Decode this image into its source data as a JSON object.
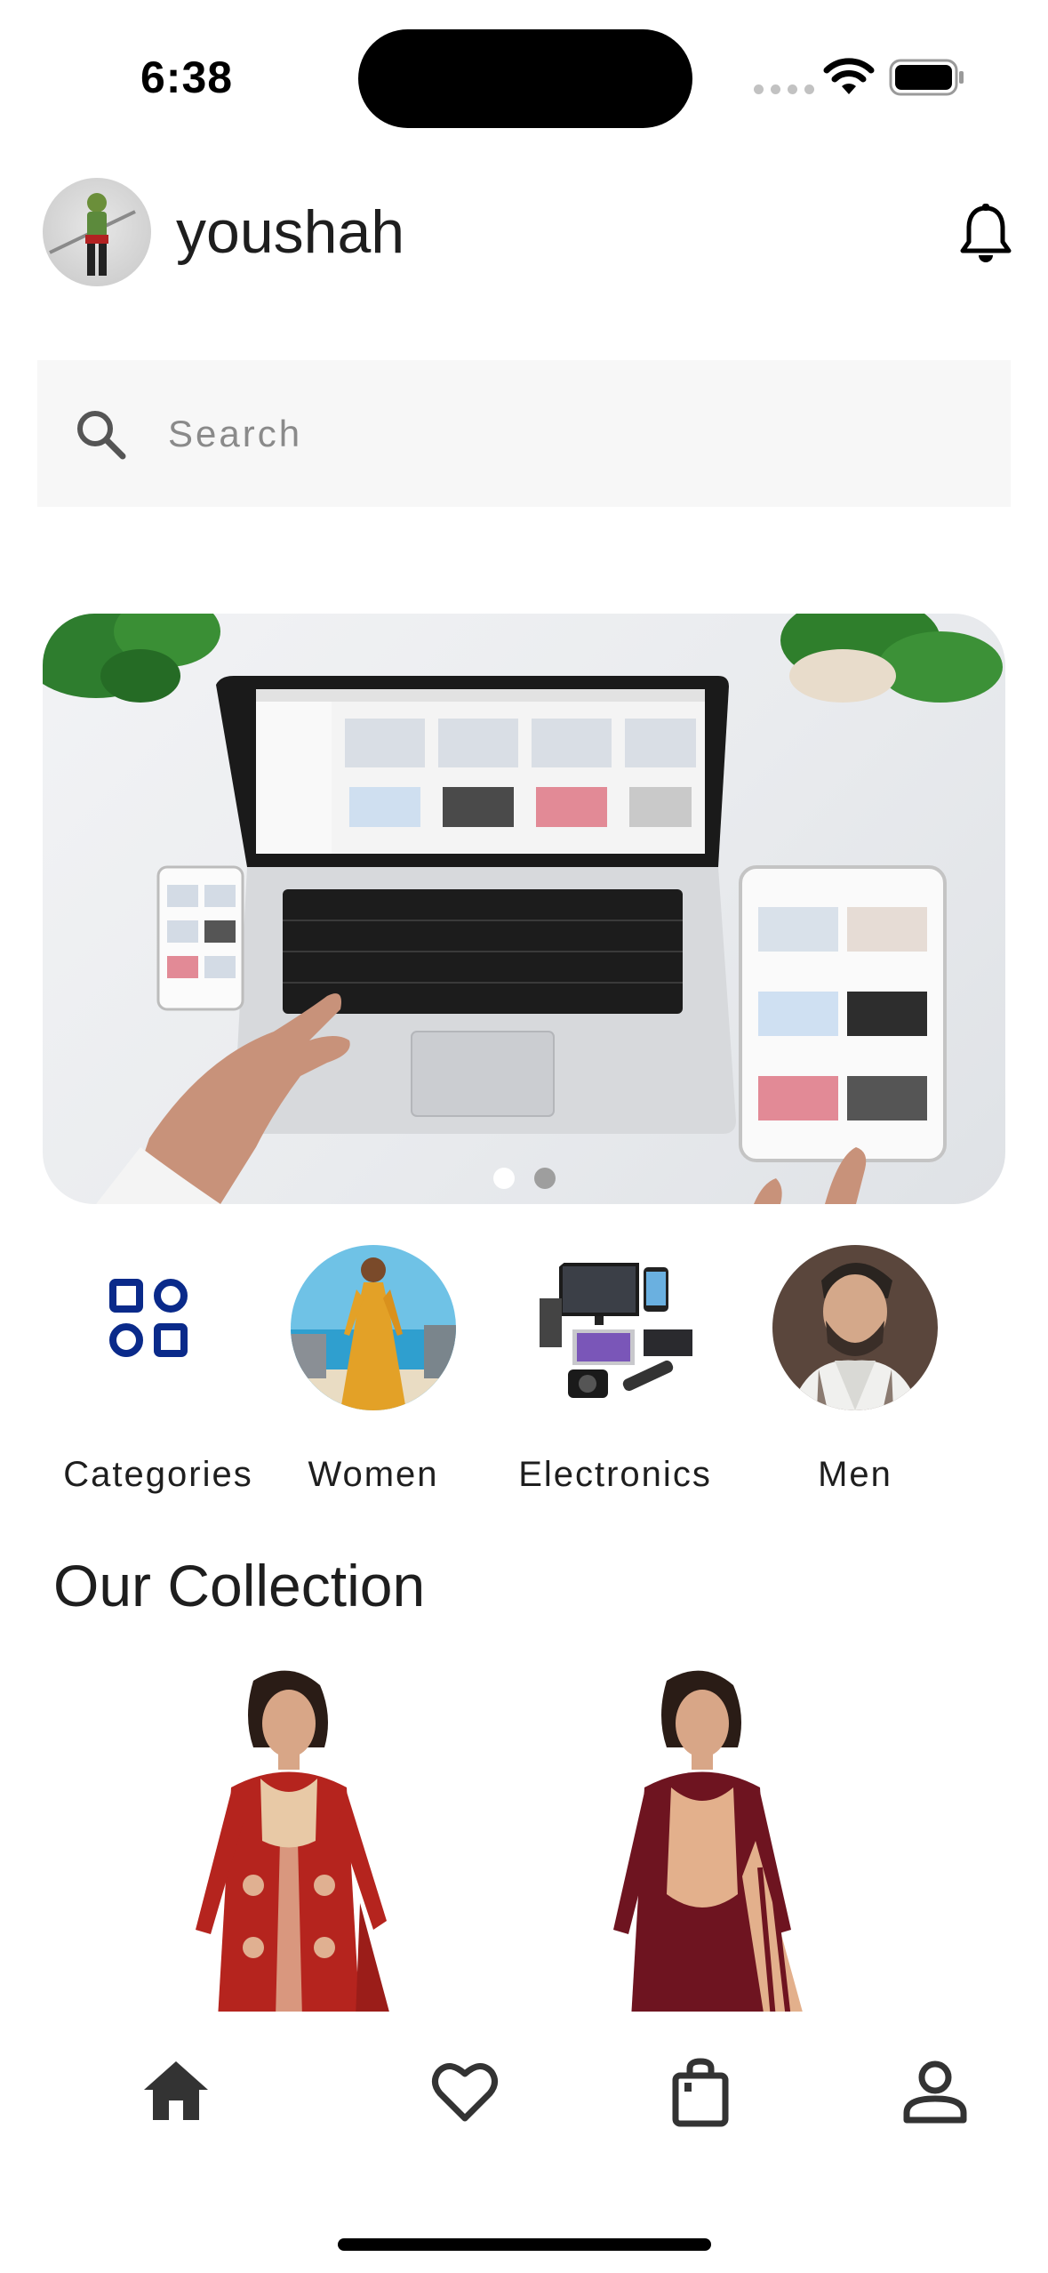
{
  "status_bar": {
    "time": "6:38"
  },
  "header": {
    "username": "youshah",
    "avatar_icon": "avatar-image",
    "notification_icon": "bell-icon"
  },
  "search": {
    "placeholder": "Search",
    "icon": "search-icon"
  },
  "banner": {
    "dot_count": 2,
    "active_dot": 0,
    "colors": {
      "active_dot": "#ffffff",
      "inactive_dot": "#9e9e9e"
    }
  },
  "categories": [
    {
      "label": "Categories",
      "icon": "grid-icon"
    },
    {
      "label": "Women",
      "icon": "women-image"
    },
    {
      "label": "Electronics",
      "icon": "electronics-image"
    },
    {
      "label": "Men",
      "icon": "men-image"
    }
  ],
  "collection": {
    "title": "Our Collection"
  },
  "bottom_nav": [
    {
      "name": "home",
      "icon": "home-icon",
      "active": true
    },
    {
      "name": "wishlist",
      "icon": "heart-icon",
      "active": false
    },
    {
      "name": "cart",
      "icon": "shopping-bag-icon",
      "active": false
    },
    {
      "name": "profile",
      "icon": "person-icon",
      "active": false
    }
  ],
  "colors": {
    "accent": "#0a2a8a",
    "text": "#1e1e1e",
    "nav_icon": "#333333"
  }
}
